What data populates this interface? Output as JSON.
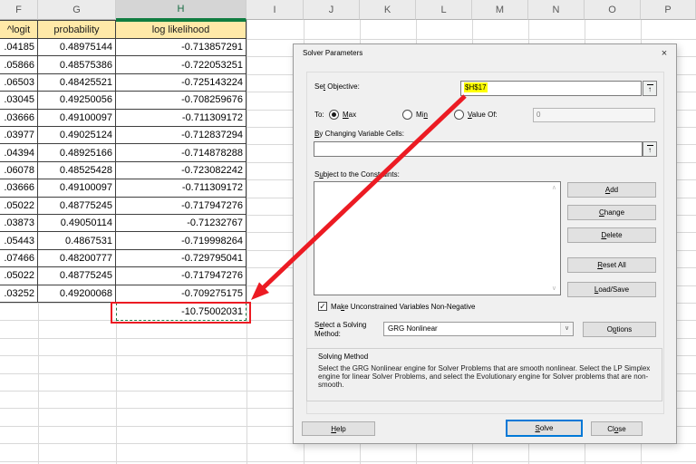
{
  "colors": {
    "annotation_red": "#ec1b23",
    "highlight_yellow": "#ffff00",
    "table_header_fill": "#ffe9a8",
    "excel_green": "#107c41",
    "focus_blue": "#0078d7",
    "dialog_bg": "#f0f0f0",
    "button_bg": "#e1e1e1"
  },
  "sheet": {
    "column_letters": [
      "F",
      "G",
      "H",
      "I",
      "J",
      "K",
      "L",
      "M",
      "N",
      "O",
      "P"
    ],
    "selected_column": "H",
    "table_headers": [
      "^logit",
      "probability",
      "log likelihood"
    ],
    "rows": [
      [
        ".04185",
        "0.48975144",
        "-0.713857291"
      ],
      [
        ".05866",
        "0.48575386",
        "-0.722053251"
      ],
      [
        ".06503",
        "0.48425521",
        "-0.725143224"
      ],
      [
        ".03045",
        "0.49250056",
        "-0.708259676"
      ],
      [
        ".03666",
        "0.49100097",
        "-0.711309172"
      ],
      [
        ".03977",
        "0.49025124",
        "-0.712837294"
      ],
      [
        ".04394",
        "0.48925166",
        "-0.714878288"
      ],
      [
        ".06078",
        "0.48525428",
        "-0.723082242"
      ],
      [
        ".03666",
        "0.49100097",
        "-0.711309172"
      ],
      [
        ".05022",
        "0.48775245",
        "-0.717947276"
      ],
      [
        ".03873",
        "0.49050114",
        "-0.71232767"
      ],
      [
        ".05443",
        "0.4867531",
        "-0.719998264"
      ],
      [
        ".07466",
        "0.48200777",
        "-0.729795041"
      ],
      [
        ".05022",
        "0.48775245",
        "-0.717947276"
      ],
      [
        ".03252",
        "0.49200068",
        "-0.709275175"
      ]
    ],
    "objective_cell_value": "-10.75002031"
  },
  "dialog": {
    "title": "Solver Parameters",
    "close_glyph": "×",
    "set_objective_label": {
      "pre": "Se",
      "key": "t",
      "post": " Objective:"
    },
    "objective_value": "$H$17",
    "refedit_glyph": "↑",
    "to_label": "To:",
    "max_label": {
      "pre": "",
      "key": "M",
      "post": "ax"
    },
    "min_label": {
      "pre": "Mi",
      "key": "n",
      "post": ""
    },
    "value_of_label": {
      "pre": "",
      "key": "V",
      "post": "alue Of:"
    },
    "value_of_value": "0",
    "by_changing_label": {
      "pre": "",
      "key": "B",
      "post": "y Changing Variable Cells:"
    },
    "by_changing_value": "",
    "subject_label": {
      "pre": "S",
      "key": "u",
      "post": "bject to the Constraints:"
    },
    "add_button": {
      "pre": "",
      "key": "A",
      "post": "dd"
    },
    "change_button": {
      "pre": "",
      "key": "C",
      "post": "hange"
    },
    "delete_button": {
      "pre": "",
      "key": "D",
      "post": "elete"
    },
    "reset_all_button": {
      "pre": "",
      "key": "R",
      "post": "eset All"
    },
    "load_save_button": {
      "pre": "",
      "key": "L",
      "post": "oad/Save"
    },
    "scroll_up_glyph": "∧",
    "scroll_down_glyph": "∨",
    "non_negative_checkbox": {
      "pre": "Ma",
      "key": "k",
      "post": "e Unconstrained Variables Non-Negative"
    },
    "checkbox_checked_glyph": "✓",
    "solving_method_label_line1": {
      "pre": "S",
      "key": "e",
      "post": "lect a Solving"
    },
    "solving_method_label_line2": "Method:",
    "solving_method_value": "GRG Nonlinear",
    "dropdown_chevron": "∨",
    "options_button": {
      "pre": "O",
      "key": "p",
      "post": "tions"
    },
    "group_title": "Solving Method",
    "group_description": "Select the GRG Nonlinear engine for Solver Problems that are smooth nonlinear. Select the LP Simplex engine for linear Solver Problems, and select the Evolutionary engine for Solver problems that are non-smooth.",
    "help_button": {
      "pre": "",
      "key": "H",
      "post": "elp"
    },
    "solve_button": {
      "pre": "",
      "key": "S",
      "post": "olve"
    },
    "close_button": {
      "pre": "Cl",
      "key": "o",
      "post": "se"
    }
  }
}
